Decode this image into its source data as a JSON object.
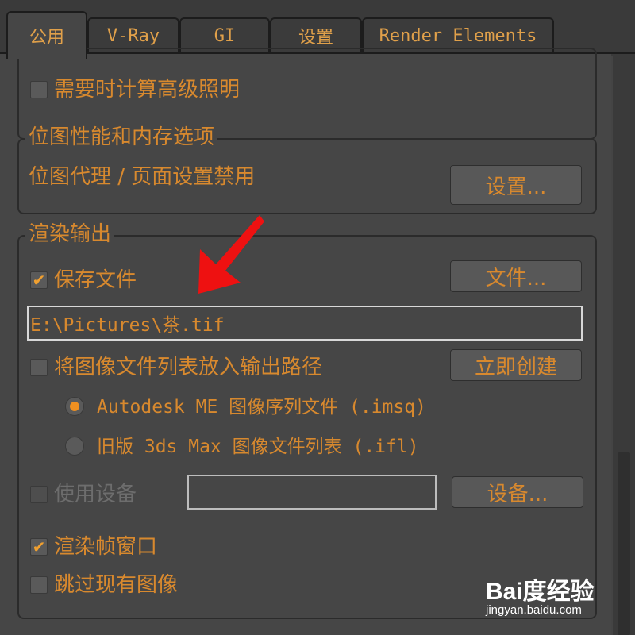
{
  "tabs": [
    {
      "label": "公用",
      "active": true
    },
    {
      "label": "V-Ray",
      "active": false
    },
    {
      "label": "GI",
      "active": false
    },
    {
      "label": "设置",
      "active": false
    },
    {
      "label": "Render Elements",
      "active": false
    }
  ],
  "top_group": {
    "checkbox_label": "需要时计算高级照明",
    "checked": false
  },
  "bitmap_group": {
    "title": "位图性能和内存选项",
    "status_text": "位图代理 / 页面设置禁用",
    "settings_button": "设置..."
  },
  "render_output": {
    "title": "渲染输出",
    "save_file_label": "保存文件",
    "save_file_checked": true,
    "file_button": "文件...",
    "file_path": "E:\\Pictures\\茶.tif",
    "put_image_list_label": "将图像文件列表放入输出路径",
    "put_image_list_checked": false,
    "create_now_button": "立即创建",
    "radio_autodesk": "Autodesk ME 图像序列文件 (.imsq)",
    "radio_autodesk_selected": true,
    "radio_legacy": "旧版 3ds Max 图像文件列表 (.ifl)",
    "radio_legacy_selected": false,
    "use_device_label": "使用设备",
    "use_device_enabled": false,
    "device_value": "",
    "devices_button": "设备...",
    "rendered_frame_window_label": "渲染帧窗口",
    "rendered_frame_window_checked": true,
    "skip_existing_label": "跳过现有图像",
    "skip_existing_checked": false
  },
  "watermark": {
    "logo": "Bai度经验",
    "url": "jingyan.baidu.com"
  },
  "colors": {
    "accent": "#d8892e",
    "background": "#464646",
    "annotation_arrow": "#ee1111"
  },
  "icons": {
    "check": "checkmark-icon",
    "annotation": "red-arrow-annotation"
  }
}
